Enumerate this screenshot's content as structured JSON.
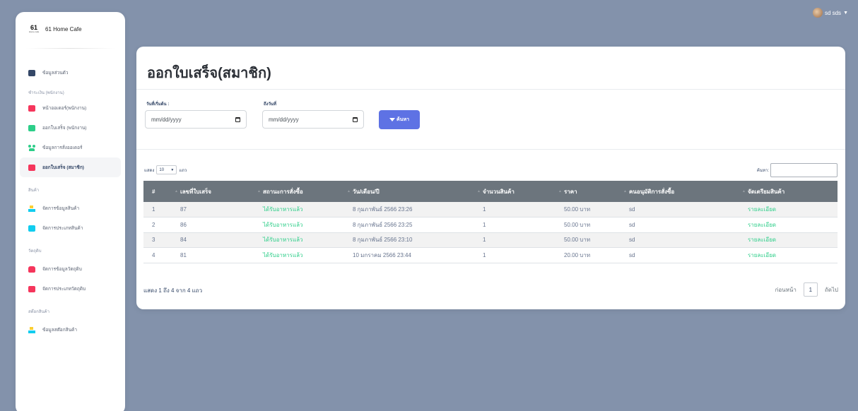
{
  "brand": {
    "logo_text": "61",
    "logo_sub": "Home cafe",
    "name": "61 Home Cafe"
  },
  "user": {
    "name": "sd sds"
  },
  "sidebar": {
    "items": [
      {
        "label": "ข้อมูลส่วนตัว",
        "icon": "id-card-icon"
      },
      {
        "heading": "ชำระเงิน (พนักงาน)"
      },
      {
        "label": "หน้าออเดอร์(พนักงาน)",
        "icon": "receipt-icon"
      },
      {
        "label": "ออกใบเสร็จ (พนักงาน)",
        "icon": "receipt-icon"
      },
      {
        "label": "ข้อมูลการสั่งออเดอร์",
        "icon": "users-icon"
      },
      {
        "label": "ออกใบเสร็จ (สมาชิก)",
        "icon": "receipt-icon",
        "active": true
      },
      {
        "heading": "สินค้า"
      },
      {
        "label": "จัดการข้อมูลสินค้า",
        "icon": "boxes-icon"
      },
      {
        "label": "จัดการประเภทสินค้า",
        "icon": "receipt-icon"
      },
      {
        "heading": "วัตถุดิบ"
      },
      {
        "label": "จัดการข้อมูลวัตถุดิบ",
        "icon": "box-icon"
      },
      {
        "label": "จัดการประเภทวัตถุดิบ",
        "icon": "receipt-icon"
      },
      {
        "heading": "สต๊อกสินค้า"
      },
      {
        "label": "ข้อมูลสต๊อกสินค้า",
        "icon": "boxes-icon"
      }
    ]
  },
  "main": {
    "title": "ออกใบเสร็จ(สมาชิก)",
    "filters": {
      "start_label": "วันที่เริ่มต้น :",
      "start_value": "mm/dd/yyyy",
      "end_label": "ถึงวันที่",
      "end_value": "mm/dd/yyyy",
      "search_button": "ค้นหา"
    },
    "table_controls": {
      "show_label": "แสดง",
      "length_value": "10",
      "rows_label": "แถว",
      "search_label": "ค้นหา:"
    },
    "table": {
      "headers": [
        "#",
        "เลขที่ใบเสร็จ",
        "สถานะการสั่งซื้อ",
        "วัน/เดือน/ปี",
        "จำนวนสินค้า",
        "ราคา",
        "คนอนุมัติการสั่งซื้อ",
        "จัดเตรียมสินค้า"
      ],
      "rows": [
        [
          "1",
          "87",
          "ได้รับอาหารแล้ว",
          "8 กุมภาพันธ์ 2566 23:26",
          "1",
          "50.00 บาท",
          "sd",
          "รายละเอียด"
        ],
        [
          "2",
          "86",
          "ได้รับอาหารแล้ว",
          "8 กุมภาพันธ์ 2566 23:25",
          "1",
          "50.00 บาท",
          "sd",
          "รายละเอียด"
        ],
        [
          "3",
          "84",
          "ได้รับอาหารแล้ว",
          "8 กุมภาพันธ์ 2566 23:10",
          "1",
          "50.00 บาท",
          "sd",
          "รายละเอียด"
        ],
        [
          "4",
          "81",
          "ได้รับอาหารแล้ว",
          "10 มกราคม 2566 23:44",
          "1",
          "20.00 บาท",
          "sd",
          "รายละเอียด"
        ]
      ]
    },
    "info": "แสดง 1 ถึง 4 จาก 4 แถว",
    "pager": {
      "prev": "ก่อนหน้า",
      "current": "1",
      "next": "ถัดไป"
    }
  },
  "colors": {
    "background": "#8392ab",
    "accent": "#5e72e4",
    "status_green": "#2dce89",
    "header_gray": "#6c757d"
  }
}
